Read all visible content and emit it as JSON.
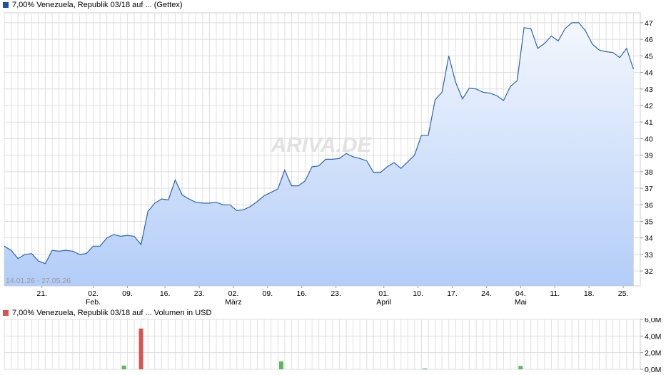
{
  "price_legend": {
    "label": "7,00% Venezuela, Republik 03/18 auf ... (Gettex)",
    "color": "#1e4f9e"
  },
  "volume_legend": {
    "label": "7,00% Venezuela, Republik 03/18 auf ... Volumen in USD",
    "color": "#d9534f"
  },
  "watermark": "ARIVA.DE",
  "date_range": "14.01.26 - 27.05.26",
  "chart_data": [
    {
      "type": "area",
      "yticks": [
        32,
        33,
        34,
        35,
        36,
        37,
        38,
        39,
        40,
        41,
        42,
        43,
        44,
        45,
        46,
        47
      ],
      "ylim": [
        31.1,
        47.6
      ],
      "xlim": [
        0,
        93
      ],
      "grid": true,
      "line_color": "#2b64b5",
      "fill_top_color": "#f3f7fe",
      "fill_bottom_color": "#b3cdf7",
      "xticks": [
        {
          "x": 5.5,
          "label": "21.",
          "month": ""
        },
        {
          "x": 13,
          "label": "02.",
          "month": "Feb."
        },
        {
          "x": 18,
          "label": "09.",
          "month": ""
        },
        {
          "x": 23.5,
          "label": "16.",
          "month": ""
        },
        {
          "x": 28.5,
          "label": "23.",
          "month": ""
        },
        {
          "x": 33.5,
          "label": "02.",
          "month": "März"
        },
        {
          "x": 38.5,
          "label": "09.",
          "month": ""
        },
        {
          "x": 43.5,
          "label": "16.",
          "month": ""
        },
        {
          "x": 48.5,
          "label": "23.",
          "month": ""
        },
        {
          "x": 55.5,
          "label": "01.",
          "month": "April"
        },
        {
          "x": 60.5,
          "label": "10.",
          "month": ""
        },
        {
          "x": 65.5,
          "label": "17.",
          "month": ""
        },
        {
          "x": 70.5,
          "label": "24.",
          "month": ""
        },
        {
          "x": 75.5,
          "label": "04.",
          "month": "Mai"
        },
        {
          "x": 80.5,
          "label": "11.",
          "month": ""
        },
        {
          "x": 85.5,
          "label": "18.",
          "month": ""
        },
        {
          "x": 90.5,
          "label": "25.",
          "month": ""
        }
      ],
      "series": [
        {
          "x": [
            0,
            1,
            2,
            3,
            4,
            5,
            6,
            7,
            8,
            9,
            10,
            11,
            12,
            13,
            14,
            15,
            16,
            17,
            18,
            19,
            20,
            21,
            22,
            23,
            24,
            25,
            26,
            27,
            28,
            29,
            30,
            31,
            32,
            33,
            34,
            35,
            36,
            37,
            38,
            39,
            40,
            41,
            42,
            43,
            44,
            45,
            46,
            47,
            48,
            49,
            50,
            51,
            52,
            53,
            54,
            55,
            56,
            57,
            58,
            59,
            60,
            61,
            62,
            63,
            64,
            65,
            66,
            67,
            68,
            69,
            70,
            71,
            72,
            73,
            74,
            75,
            76,
            77,
            78,
            79,
            80,
            81,
            82,
            83,
            84,
            85,
            86,
            87,
            88,
            89,
            90,
            91,
            92
          ],
          "values": [
            33.5,
            33.25,
            32.75,
            33.0,
            33.05,
            32.6,
            32.45,
            33.25,
            33.2,
            33.25,
            33.2,
            33.0,
            33.05,
            33.5,
            33.5,
            34.0,
            34.2,
            34.1,
            34.15,
            34.1,
            33.6,
            35.6,
            36.1,
            36.35,
            36.3,
            37.5,
            36.6,
            36.35,
            36.15,
            36.1,
            36.1,
            36.15,
            36.0,
            36.0,
            35.65,
            35.7,
            35.9,
            36.2,
            36.55,
            36.75,
            36.95,
            38.1,
            37.15,
            37.15,
            37.45,
            38.3,
            38.35,
            38.75,
            38.75,
            38.8,
            39.1,
            38.9,
            38.8,
            38.65,
            37.95,
            37.95,
            38.3,
            38.55,
            38.2,
            38.6,
            39.0,
            40.2,
            40.2,
            42.35,
            42.8,
            45.0,
            43.4,
            42.4,
            43.05,
            43.0,
            42.8,
            42.75,
            42.6,
            42.3,
            43.15,
            43.5,
            46.7,
            46.65,
            45.45,
            45.75,
            46.2,
            45.9,
            46.65,
            47.0,
            47.0,
            46.5,
            45.7,
            45.35,
            45.25,
            45.2,
            44.9,
            45.45,
            44.2
          ]
        }
      ]
    },
    {
      "type": "bar",
      "yticks": [
        0,
        2,
        4,
        6
      ],
      "ytick_labels": [
        "0,0M",
        "2,0M",
        "4,0M",
        "6,0M"
      ],
      "ylim": [
        0,
        6
      ],
      "grid": true,
      "series": [
        {
          "x": [
            17.5,
            20,
            40.5,
            61.5,
            75.5
          ],
          "values": [
            0.45,
            4.9,
            0.95,
            0.1,
            0.4
          ],
          "colors": [
            "#5cb85c",
            "#d9534f",
            "#5cb85c",
            "#5cb85c",
            "#5cb85c"
          ]
        }
      ]
    }
  ]
}
